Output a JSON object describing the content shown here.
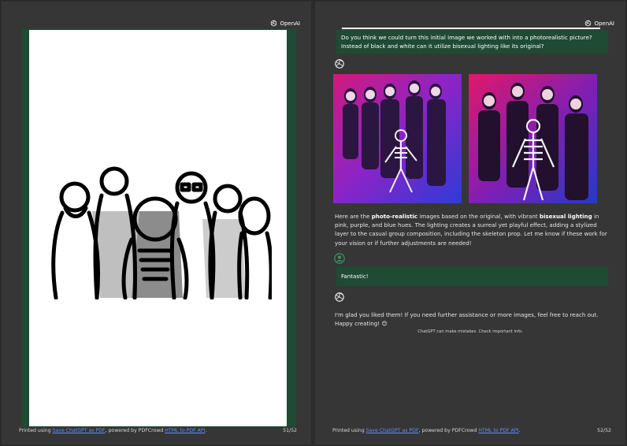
{
  "brand": {
    "name": "OpenAI"
  },
  "pages": [
    {
      "footer": {
        "prefix": "Printed using ",
        "link1": "Save ChatGPT as PDF",
        "middle": ", powered by PDFCrowd ",
        "link2": "HTML to PDF API",
        "suffix": ".",
        "page": "51/52"
      }
    },
    {
      "footer": {
        "prefix": "Printed using ",
        "link1": "Save ChatGPT as PDF",
        "middle": ", powered by PDFCrowd ",
        "link2": "HTML to PDF API",
        "suffix": ".",
        "page": "52/52"
      }
    }
  ],
  "chat": {
    "user_question": "Do you think we could turn this initial image we worked with into a photorealistic picture? Instead of black and white can it utilize bisexual lighting like its original?",
    "reply1": {
      "part1": "Here are the ",
      "bold1": "photo-realistic",
      "part2": " images based on the original, with vibrant ",
      "bold2": "bisexual lighting",
      "part3": " in pink, purple, and blue hues. The lighting creates a surreal yet playful effect, adding a stylized layer to the casual group composition, including the skeleton prop. Let me know if these work for your vision or if further adjustments are needed!"
    },
    "user_reply": "Fantastic!",
    "reply2": "I'm glad you liked them! If you need further assistance or more images, feel free to reach out. Happy creating! 😊",
    "disclaimer": "ChatGPT can make mistakes. Check important info."
  }
}
